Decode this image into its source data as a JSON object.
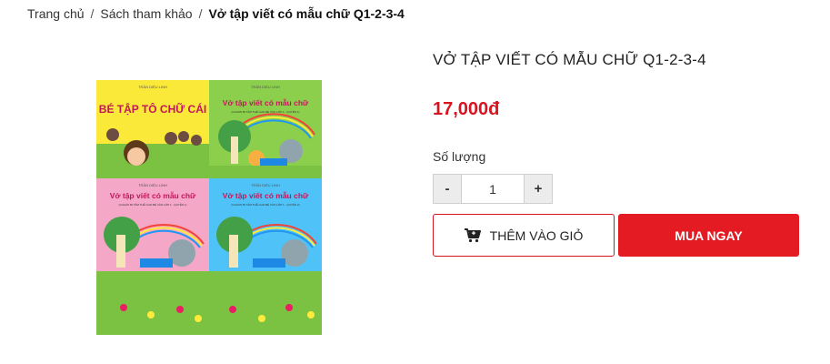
{
  "breadcrumb": {
    "home": "Trang chủ",
    "category": "Sách tham khảo",
    "current": "Vở tập viết có mẫu chữ Q1-2-3-4",
    "separator": "/"
  },
  "product": {
    "title": "VỞ TẬP VIẾT CÓ MẪU CHỮ Q1-2-3-4",
    "price": "17,000đ",
    "quantity_label": "Số lượng",
    "quantity_value": "1",
    "minus": "-",
    "plus": "+",
    "add_to_cart": "THÊM VÀO GIỎ",
    "buy_now": "MUA NGAY",
    "cover_texts": {
      "author": "TRẦN DIỆU LINH",
      "book1": "BÉ TẬP TÔ CHỮ CÁI",
      "book2": "Vở tập viết có mẫu chữ",
      "subtitle_q1": "(CHUẨN BỊ TÂM THẾ CHO BÉ VÀO LỚP 1 - QUYỂN 1)",
      "subtitle_q2": "(CHUẨN BỊ TÂM THẾ CHO BÉ VÀO LỚP 1 - QUYỂN 2)"
    }
  },
  "colors": {
    "accent": "#e51b24",
    "price": "#d7141f"
  }
}
